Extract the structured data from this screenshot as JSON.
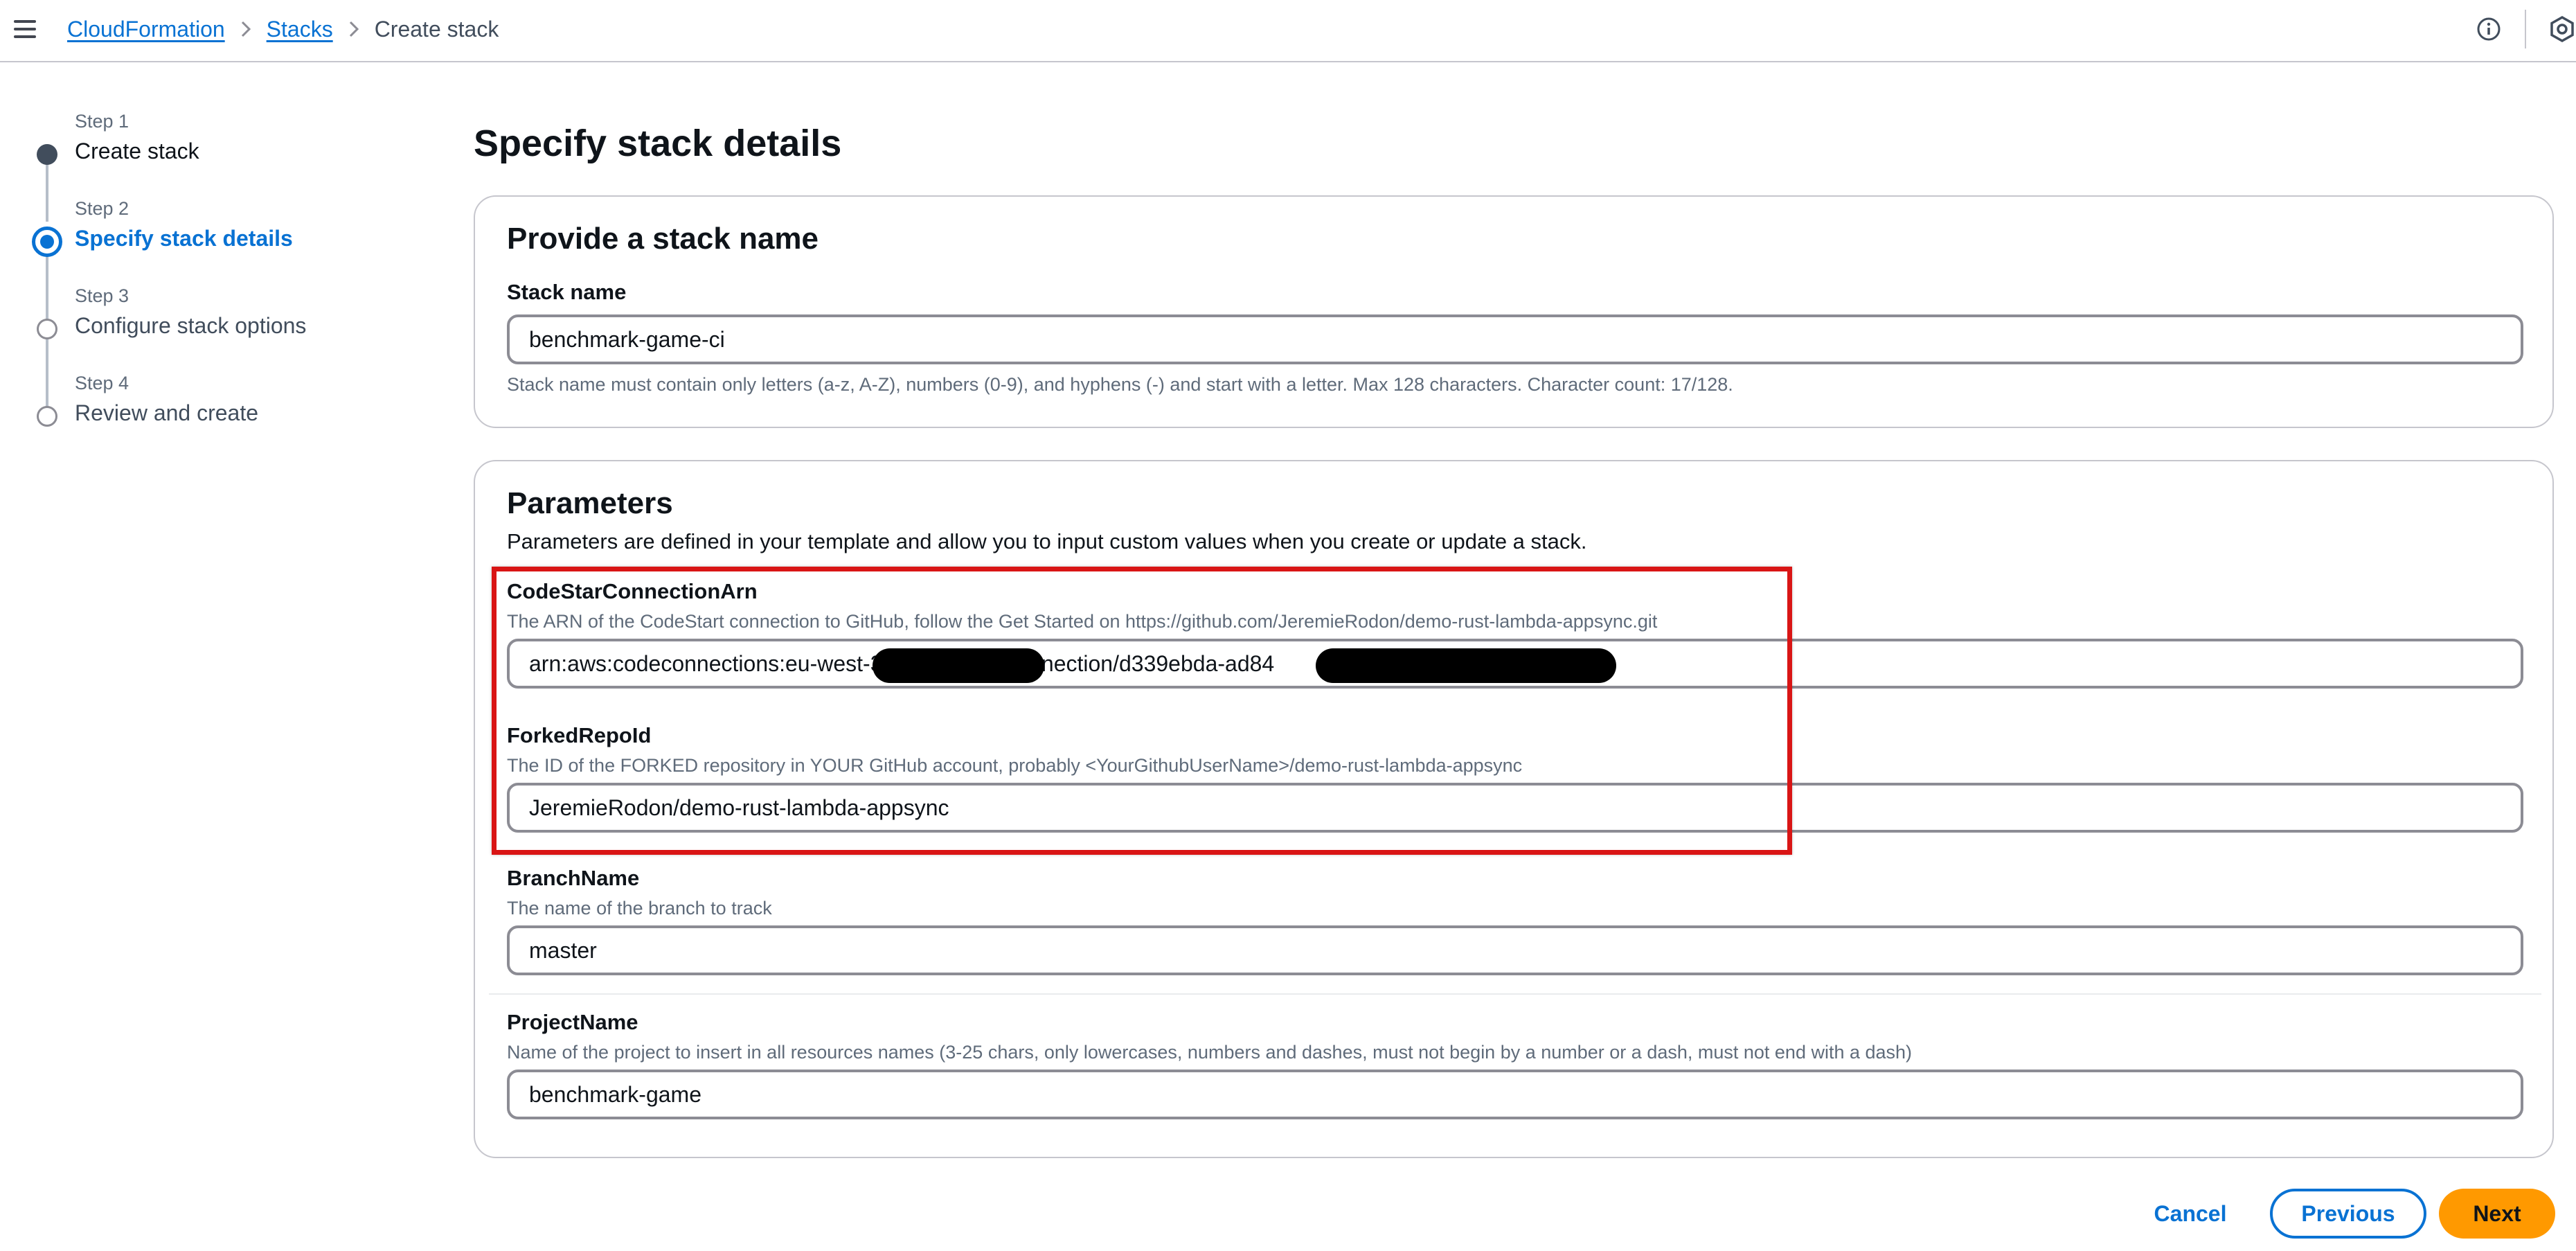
{
  "header": {
    "menu_icon": "hamburger-menu-icon",
    "breadcrumb": {
      "service": "CloudFormation",
      "stacks": "Stacks",
      "current": "Create stack"
    },
    "info_icon": "info-circle-icon",
    "settings_icon": "hexagon-settings-icon"
  },
  "steps": [
    {
      "number": "Step 1",
      "title": "Create stack",
      "state": "completed"
    },
    {
      "number": "Step 2",
      "title": "Specify stack details",
      "state": "active"
    },
    {
      "number": "Step 3",
      "title": "Configure stack options",
      "state": "pending"
    },
    {
      "number": "Step 4",
      "title": "Review and create",
      "state": "pending"
    }
  ],
  "main": {
    "title": "Specify stack details",
    "stack_name_section": {
      "heading": "Provide a stack name",
      "label": "Stack name",
      "value": "benchmark-game-ci",
      "help": "Stack name must contain only letters (a-z, A-Z), numbers (0-9), and hyphens (-) and start with a letter. Max 128 characters. Character count: 17/128."
    },
    "parameters": {
      "heading": "Parameters",
      "description": "Parameters are defined in your template and allow you to input custom values when you create or update a stack.",
      "fields": [
        {
          "label": "CodeStarConnectionArn",
          "description": "The ARN of the CodeStart connection to GitHub, follow the Get Started on https://github.com/JeremieRodon/demo-rust-lambda-appsync.git",
          "value": "arn:aws:codeconnections:eu-west-3                    connection/d339ebda-ad84"
        },
        {
          "label": "ForkedRepoId",
          "description": "The ID of the FORKED repository in YOUR GitHub account, probably <YourGithubUserName>/demo-rust-lambda-appsync",
          "value": "JeremieRodon/demo-rust-lambda-appsync"
        },
        {
          "label": "BranchName",
          "description": "The name of the branch to track",
          "value": "master"
        },
        {
          "label": "ProjectName",
          "description": "Name of the project to insert in all resources names (3-25 chars, only lowercases, numbers and dashes, must not begin by a number or a dash, must not end with a dash)",
          "value": "benchmark-game"
        }
      ]
    }
  },
  "footer": {
    "cancel": "Cancel",
    "previous": "Previous",
    "next": "Next"
  },
  "colors": {
    "link_blue": "#0972d3",
    "primary_orange": "#ff9900",
    "highlight_red": "#d91515",
    "text_dark": "#0f141a",
    "text_muted": "#5f6b7a"
  }
}
